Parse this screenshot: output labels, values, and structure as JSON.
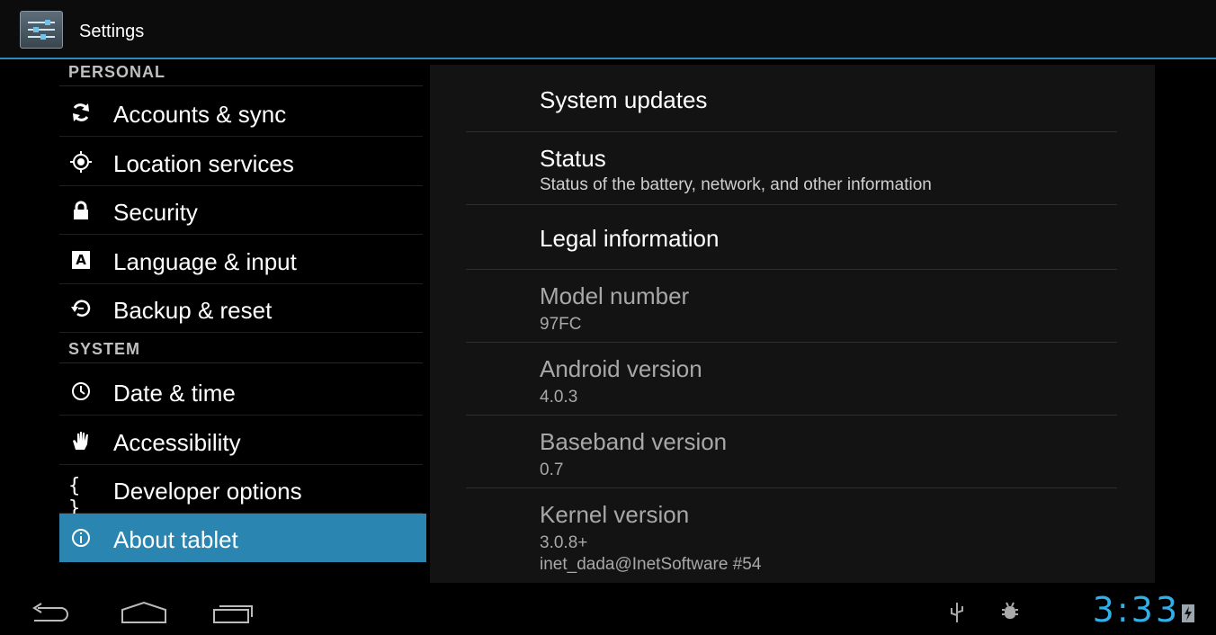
{
  "action_bar": {
    "title": "Settings",
    "icon": "settings-icon"
  },
  "sidebar": {
    "personal_header": "PERSONAL",
    "system_header": "SYSTEM",
    "personal_items": [
      {
        "label": "Accounts & sync",
        "icon": "sync-icon"
      },
      {
        "label": "Location services",
        "icon": "location-icon"
      },
      {
        "label": "Security",
        "icon": "lock-icon"
      },
      {
        "label": "Language & input",
        "icon": "language-icon"
      },
      {
        "label": "Backup & reset",
        "icon": "backup-icon"
      }
    ],
    "system_items": [
      {
        "label": "Date & time",
        "icon": "clock-icon"
      },
      {
        "label": "Accessibility",
        "icon": "hand-icon"
      },
      {
        "label": "Developer options",
        "icon": "braces-icon",
        "glyph": "{ }"
      },
      {
        "label": "About tablet",
        "icon": "info-icon",
        "selected": true
      }
    ]
  },
  "about": {
    "system_updates": {
      "title": "System updates"
    },
    "status": {
      "title": "Status",
      "summary": "Status of the battery, network, and other information"
    },
    "legal": {
      "title": "Legal information"
    },
    "model": {
      "title": "Model number",
      "summary": "97FC"
    },
    "android": {
      "title": "Android version",
      "summary": "4.0.3"
    },
    "baseband": {
      "title": "Baseband version",
      "summary": "0.7"
    },
    "kernel": {
      "title": "Kernel version",
      "summary_line1": "3.0.8+",
      "summary_line2": "inet_dada@InetSoftware #54"
    }
  },
  "status_bar": {
    "time": "3:33",
    "icons": [
      "usb-icon",
      "debug-icon",
      "battery-icon"
    ]
  },
  "nav": {
    "buttons": [
      "back-icon",
      "home-icon",
      "recent-apps-icon"
    ]
  },
  "colors": {
    "accent": "#2a86b0",
    "clock": "#2fb0e8",
    "divider": "#2a8ab8"
  }
}
